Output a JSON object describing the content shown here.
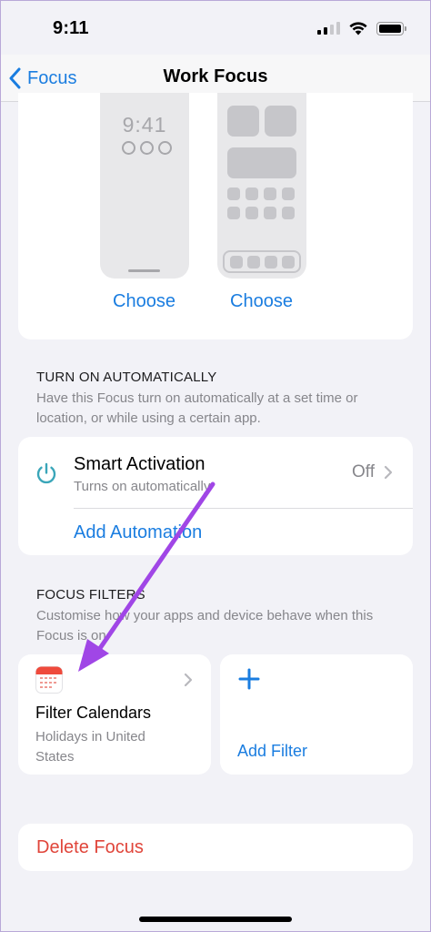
{
  "status_bar": {
    "time": "9:11"
  },
  "nav": {
    "back_label": "Focus",
    "title": "Work Focus"
  },
  "preview": {
    "lock_time": "9:41",
    "choose_lock_label": "Choose",
    "choose_home_label": "Choose"
  },
  "automation": {
    "section_header": "TURN ON AUTOMATICALLY",
    "section_desc": "Have this Focus turn on automatically at a set time or location, or while using a certain app.",
    "smart_activation_title": "Smart Activation",
    "smart_activation_sub": "Turns on automatically",
    "smart_activation_value": "Off",
    "add_automation_label": "Add Automation"
  },
  "filters": {
    "section_header": "FOCUS FILTERS",
    "section_desc": "Customise how your apps and device behave when this Focus is on.",
    "filter_calendars_title": "Filter Calendars",
    "filter_calendars_sub": "Holidays in United States",
    "add_filter_label": "Add Filter"
  },
  "delete_label": "Delete Focus",
  "colors": {
    "accent": "#1a7de0",
    "destructive": "#e0453a",
    "annotation_arrow": "#a046e6"
  },
  "icons": [
    "back-chevron-icon",
    "power-icon",
    "chevron-right-icon",
    "calendar-icon",
    "plus-icon"
  ]
}
